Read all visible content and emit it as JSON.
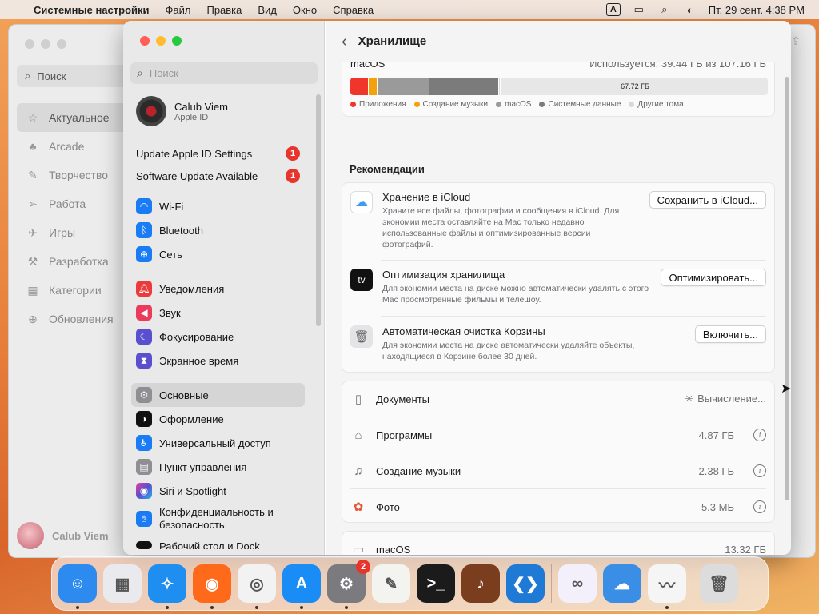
{
  "menubar": {
    "app": "Системные настройки",
    "items": [
      "Файл",
      "Правка",
      "Вид",
      "Окно",
      "Справка"
    ],
    "input_badge": "A",
    "datetime": "Пт, 29 сент.  4:38 PM"
  },
  "background_window": {
    "search_label": "Поиск",
    "nav": [
      "Актуальное",
      "Arcade",
      "Творчество",
      "Работа",
      "Игры",
      "Разработка",
      "Категории",
      "Обновления"
    ],
    "user": "Calub Viem"
  },
  "sidebar": {
    "search_placeholder": "Поиск",
    "account": {
      "name": "Calub Viem",
      "sub": "Apple ID"
    },
    "alerts": [
      {
        "label": "Update Apple ID Settings",
        "count": "1"
      },
      {
        "label": "Software Update Available",
        "count": "1"
      }
    ],
    "group1": [
      {
        "label": "Wi-Fi",
        "icon": "wifi-icon",
        "color": "#1a7cf5"
      },
      {
        "label": "Bluetooth",
        "icon": "bluetooth-icon",
        "color": "#1a7cf5"
      },
      {
        "label": "Сеть",
        "icon": "globe-icon",
        "color": "#1a7cf5"
      }
    ],
    "group2": [
      {
        "label": "Уведомления",
        "icon": "bell-icon",
        "color": "#ec3b3b"
      },
      {
        "label": "Звук",
        "icon": "speaker-icon",
        "color": "#ec3b5a"
      },
      {
        "label": "Фокусирование",
        "icon": "moon-icon",
        "color": "#5a4fcf"
      },
      {
        "label": "Экранное время",
        "icon": "hourglass-icon",
        "color": "#5a4fcf"
      }
    ],
    "group3": [
      {
        "label": "Основные",
        "icon": "gear-icon",
        "color": "#8e8e93",
        "active": true
      },
      {
        "label": "Оформление",
        "icon": "appearance-icon",
        "color": "#111111"
      },
      {
        "label": "Универсальный доступ",
        "icon": "accessibility-icon",
        "color": "#1a7cf5"
      },
      {
        "label": "Пункт управления",
        "icon": "control-center-icon",
        "color": "#8e8e93"
      },
      {
        "label": "Siri и Spotlight",
        "icon": "siri-icon",
        "color": "#b44bd6"
      },
      {
        "label": "Конфиденциальность и безопасность",
        "icon": "hand-icon",
        "color": "#1a7cf5"
      }
    ],
    "cut_off_item": "Рабочий стол и Dock"
  },
  "main": {
    "title": "Хранилище",
    "storage": {
      "volume": "macOS",
      "used_text": "Используется: 39.44 ГБ из 107.16 ГБ",
      "free_label": "67.72 ГБ",
      "segments": [
        {
          "label": "Приложения",
          "color": "#f0362b",
          "fraction": 0.045
        },
        {
          "label": "Создание музыки",
          "color": "#f5a10a",
          "fraction": 0.02
        },
        {
          "label": "macOS",
          "color": "#9a9a9a",
          "fraction": 0.124
        },
        {
          "label": "Системные данные",
          "color": "#7b7b7b",
          "fraction": 0.167
        },
        {
          "label": "Другие тома",
          "color": "#d8d8d8",
          "fraction": 0.004
        }
      ]
    },
    "recommendations_title": "Рекомендации",
    "recommendations": [
      {
        "title": "Хранение в iCloud",
        "desc": "Храните все файлы, фотографии и сообщения в iCloud. Для экономии места оставляйте на Mac только недавно использованные файлы и оптимизированные версии фотографий.",
        "button": "Сохранить в iCloud...",
        "icon": "icloud-icon"
      },
      {
        "title": "Оптимизация хранилища",
        "desc": "Для экономии места на диске можно автоматически удалять с этого Mac просмотренные фильмы и телешоу.",
        "button": "Оптимизировать...",
        "icon": "apple-tv-icon",
        "icon_text": "tv"
      },
      {
        "title": "Автоматическая очистка Корзины",
        "desc": "Для экономии места на диске автоматически удаляйте объекты, находящиеся в Корзине более 30 дней.",
        "button": "Включить...",
        "icon": "trash-icon"
      }
    ],
    "categories": [
      {
        "name": "Документы",
        "value": "Вычисление...",
        "icon": "document-icon",
        "spinner": true
      },
      {
        "name": "Программы",
        "value": "4.87 ГБ",
        "icon": "apps-icon",
        "info": true
      },
      {
        "name": "Создание музыки",
        "value": "2.38 ГБ",
        "icon": "music-creation-icon",
        "info": true
      },
      {
        "name": "Фото",
        "value": "5.3 МБ",
        "icon": "photos-icon",
        "info": true
      }
    ],
    "volumes": [
      {
        "name": "macOS",
        "value": "13.32 ГБ",
        "icon": "display-icon"
      }
    ]
  },
  "dock": {
    "apps": [
      {
        "name": "finder",
        "color": "#2d8bf0",
        "running": true
      },
      {
        "name": "launchpad",
        "color": "#e9e9ee",
        "running": false
      },
      {
        "name": "safari",
        "color": "#1f8ef1",
        "running": true
      },
      {
        "name": "firefox",
        "color": "#ff6a1a",
        "running": true
      },
      {
        "name": "chrome",
        "color": "#f2f2f2",
        "running": true
      },
      {
        "name": "app-store",
        "color": "#1a8cf5",
        "running": true
      },
      {
        "name": "system-settings",
        "color": "#7a7a7f",
        "running": true,
        "badge": "2"
      },
      {
        "name": "textedit",
        "color": "#f3f3f0",
        "running": false
      },
      {
        "name": "terminal",
        "color": "#1b1b1b",
        "running": false,
        "text": ">_"
      },
      {
        "name": "garageband",
        "color": "#7a3d1e",
        "running": false
      },
      {
        "name": "vscode",
        "color": "#1f7ad6",
        "running": false
      },
      {
        "name": "visual-studio",
        "color": "#f4f0fb",
        "running": false
      },
      {
        "name": "weather",
        "color": "#3b8ee6",
        "running": false
      },
      {
        "name": "freeform",
        "color": "#f5f5f5",
        "running": true
      },
      {
        "name": "trash",
        "color": "#dcdcdc",
        "running": false
      }
    ]
  }
}
